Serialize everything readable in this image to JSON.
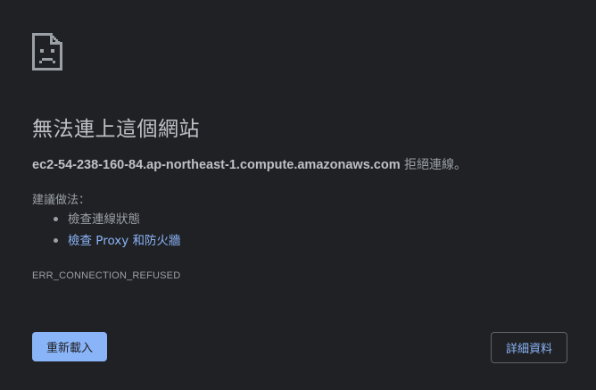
{
  "page": {
    "icon": "sad-document-icon",
    "title": "無法連上這個網站",
    "host": "ec2-54-238-160-84.ap-northeast-1.compute.amazonaws.com",
    "message_suffix": " 拒絕連線。",
    "suggestions_heading": "建議做法：",
    "suggestions": [
      {
        "label": "檢查連線狀態",
        "is_link": false
      },
      {
        "label": "檢查 Proxy 和防火牆",
        "is_link": true
      }
    ],
    "error_code": "ERR_CONNECTION_REFUSED"
  },
  "buttons": {
    "reload_label": "重新載入",
    "details_label": "詳細資料"
  },
  "colors": {
    "background": "#202124",
    "title": "#bdc1c6",
    "text": "#9aa0a6",
    "link": "#8ab4f8",
    "primary_button": "#8ab4f8"
  }
}
